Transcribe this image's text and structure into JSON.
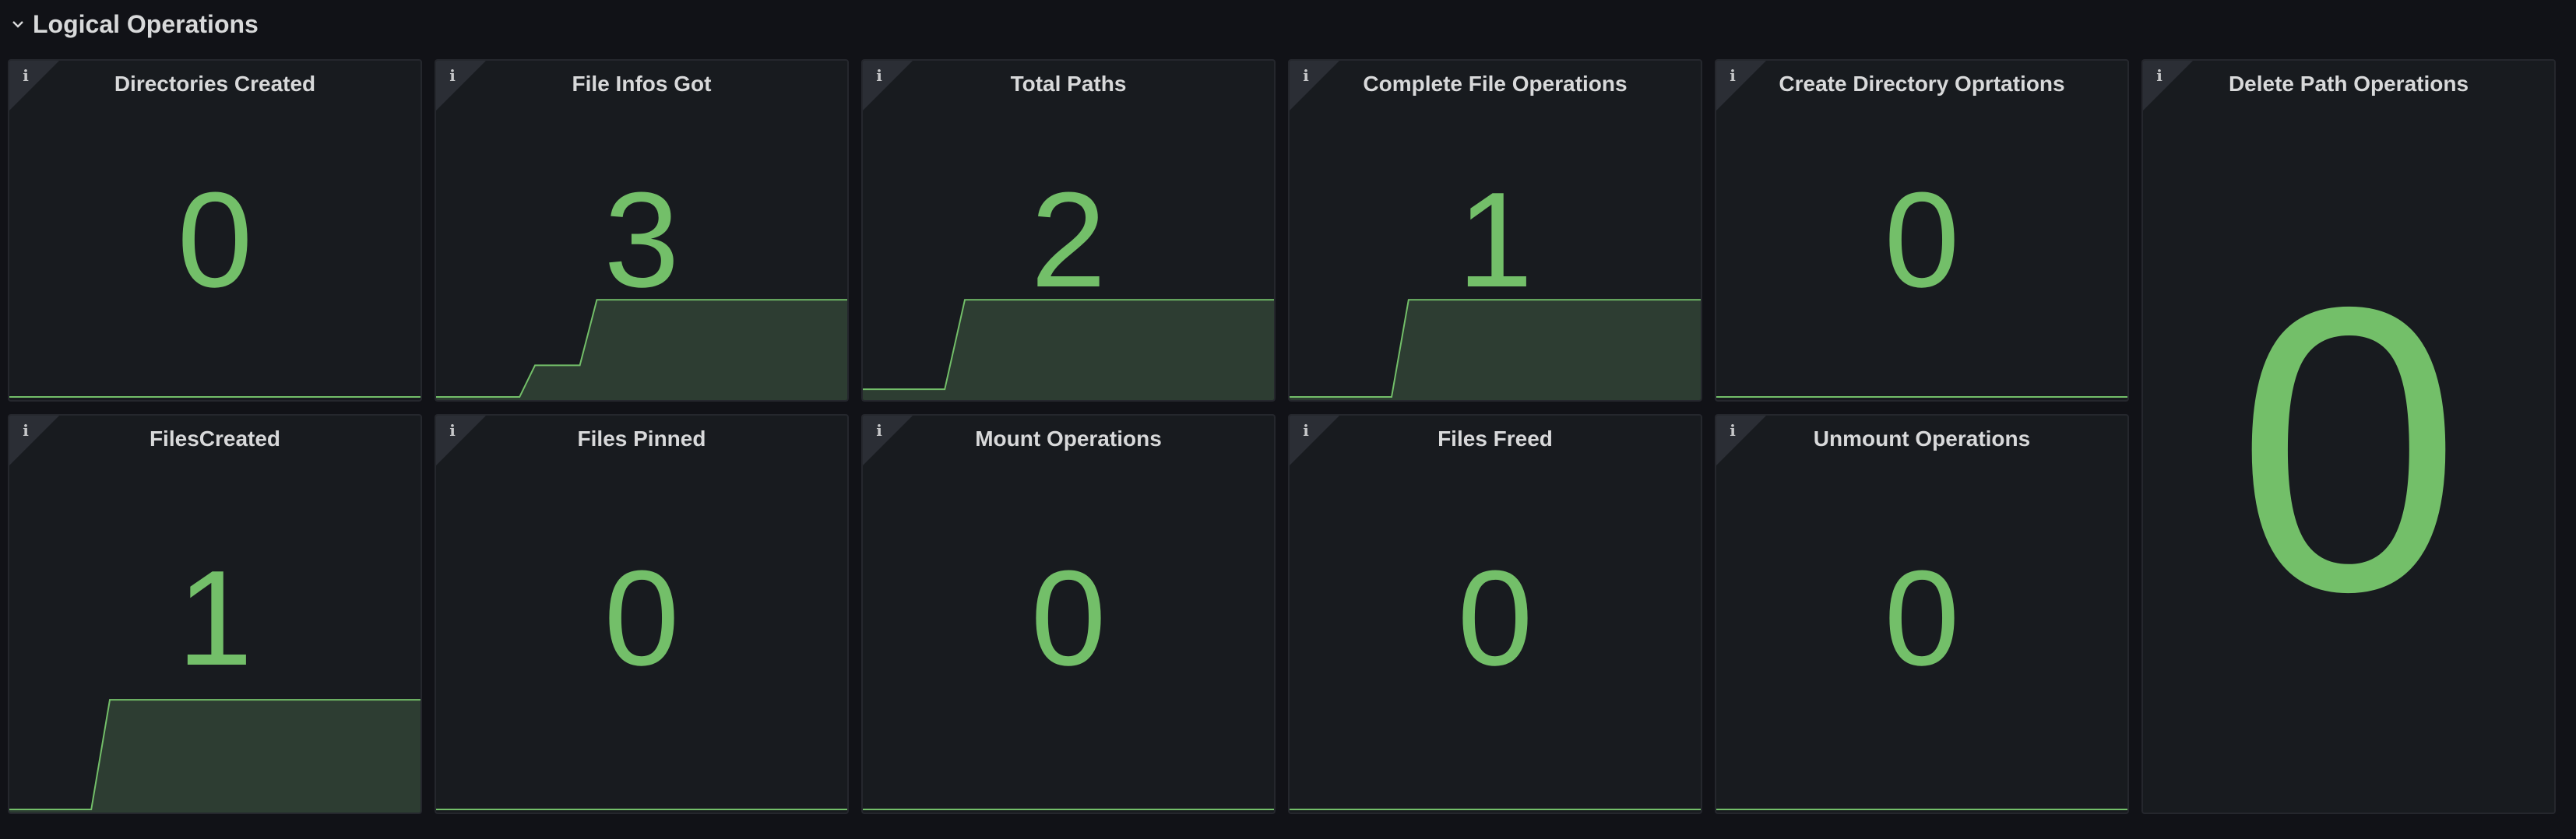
{
  "row": {
    "title": "Logical Operations",
    "collapse_icon": "chevron-down-icon"
  },
  "colors": {
    "value": "#73bf69",
    "spark_fill": "#2d3d32",
    "background": "#111217",
    "panel": "#181b1f"
  },
  "panels": {
    "directories_created": {
      "title": "Directories Created",
      "value": "0"
    },
    "file_infos_got": {
      "title": "File Infos Got",
      "value": "3"
    },
    "total_paths": {
      "title": "Total Paths",
      "value": "2"
    },
    "complete_file_operations": {
      "title": "Complete File Operations",
      "value": "1"
    },
    "create_directory_oprtations": {
      "title": "Create Directory Oprtations",
      "value": "0"
    },
    "delete_path_operations": {
      "title": "Delete Path Operations",
      "value": "0"
    },
    "files_created": {
      "title": "FilesCreated",
      "value": "1"
    },
    "files_pinned": {
      "title": "Files Pinned",
      "value": "0"
    },
    "mount_operations": {
      "title": "Mount Operations",
      "value": "0"
    },
    "files_freed": {
      "title": "Files Freed",
      "value": "0"
    },
    "unmount_operations": {
      "title": "Unmount Operations",
      "value": "0"
    }
  },
  "info_icon": "i"
}
